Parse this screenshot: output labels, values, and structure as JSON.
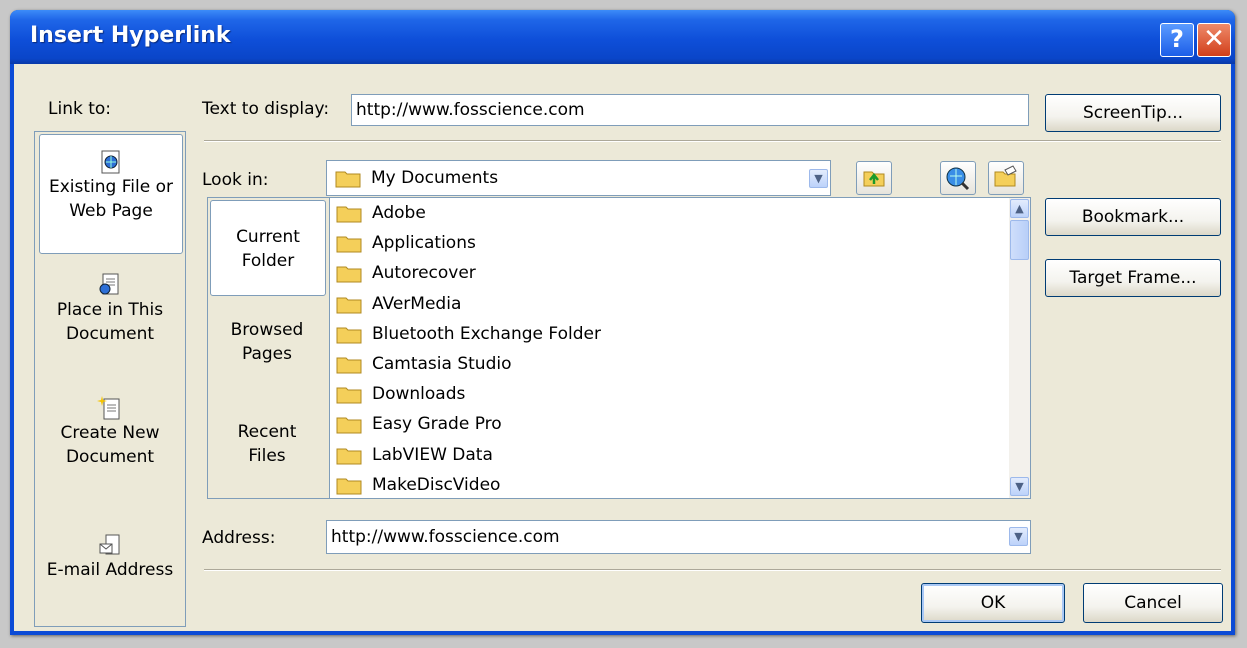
{
  "window": {
    "title": "Insert Hyperlink"
  },
  "link_to": {
    "label": "Link to:",
    "items": [
      {
        "line1": "Existing File or",
        "line2": "Web Page",
        "icon": "web-file-icon",
        "selected": true
      },
      {
        "line1": "Place in This",
        "line2": "Document",
        "icon": "place-in-document-icon",
        "selected": false
      },
      {
        "line1": "Create New",
        "line2": "Document",
        "icon": "new-document-icon",
        "selected": false
      },
      {
        "line1": "E-mail Address",
        "line2": "",
        "icon": "email-icon",
        "selected": false
      }
    ]
  },
  "text_to_display": {
    "label": "Text to display:",
    "value": "http://www.fosscience.com"
  },
  "screentip_label": "ScreenTip...",
  "look_in": {
    "label": "Look in:",
    "value": "My Documents"
  },
  "nav": [
    {
      "line1": "Current",
      "line2": "Folder",
      "selected": true
    },
    {
      "line1": "Browsed",
      "line2": "Pages",
      "selected": false
    },
    {
      "line1": "Recent",
      "line2": "Files",
      "selected": false
    }
  ],
  "files": [
    "Adobe",
    "Applications",
    "Autorecover",
    "AVerMedia",
    "Bluetooth Exchange Folder",
    "Camtasia Studio",
    "Downloads",
    "Easy Grade Pro",
    "LabVIEW Data",
    "MakeDiscVideo"
  ],
  "bookmark_label": "Bookmark...",
  "target_frame_label": "Target Frame...",
  "address": {
    "label": "Address:",
    "value": "http://www.fosscience.com"
  },
  "ok_label": "OK",
  "cancel_label": "Cancel",
  "colors": {
    "titlebar": "#0a45c8",
    "dialog_bg": "#ece9d8",
    "border": "#7f9db9",
    "folder": "#f4cf5a"
  }
}
